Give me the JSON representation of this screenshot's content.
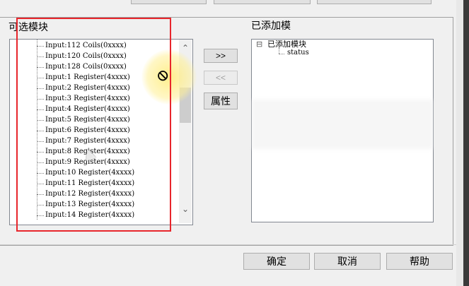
{
  "left_group": {
    "title": "可选模块"
  },
  "right_group": {
    "title": "已添加模"
  },
  "available_items": [
    "Input:112 Coils(0xxxx)",
    "Input:120 Coils(0xxxx)",
    "Input:128 Coils(0xxxx)",
    "Input:1 Register(4xxxx)",
    "Input:2 Register(4xxxx)",
    "Input:3 Register(4xxxx)",
    "Input:4 Register(4xxxx)",
    "Input:5 Register(4xxxx)",
    "Input:6 Register(4xxxx)",
    "Input:7 Register(4xxxx)",
    "Input:8 Register(4xxxx)",
    "Input:9 Register(4xxxx)",
    "Input:10 Register(4xxxx)",
    "Input:11 Register(4xxxx)",
    "Input:12 Register(4xxxx)",
    "Input:13 Register(4xxxx)",
    "Input:14 Register(4xxxx)"
  ],
  "added_tree": {
    "root_label": "已添加模块",
    "root_toggle": "⊟",
    "child_label": "status"
  },
  "buttons": {
    "add": ">>",
    "remove": "<<",
    "properties": "属性",
    "ok": "确定",
    "cancel": "取消",
    "help": "帮助"
  },
  "scroll": {
    "up": "⌃",
    "down": "⌄"
  },
  "cursor": {
    "icon": "⦸"
  },
  "colors": {
    "annotation_red": "#e8262c",
    "highlight_yellow": "#ffec78"
  }
}
